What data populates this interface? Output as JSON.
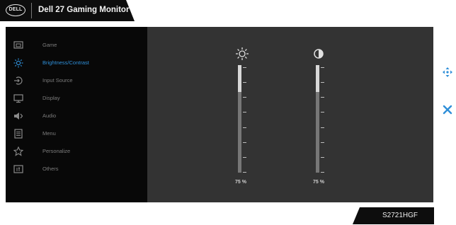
{
  "header": {
    "logo_text": "DELL",
    "title": "Dell 27 Gaming Monitor"
  },
  "menu": {
    "items": [
      {
        "label": "Game",
        "icon": "game-icon",
        "active": false
      },
      {
        "label": "Brightness/Contrast",
        "icon": "brightness-icon",
        "active": true
      },
      {
        "label": "Input Source",
        "icon": "input-source-icon",
        "active": false
      },
      {
        "label": "Display",
        "icon": "display-icon",
        "active": false
      },
      {
        "label": "Audio",
        "icon": "audio-icon",
        "active": false
      },
      {
        "label": "Menu",
        "icon": "menu-icon",
        "active": false
      },
      {
        "label": "Personalize",
        "icon": "personalize-icon",
        "active": false
      },
      {
        "label": "Others",
        "icon": "others-icon",
        "active": false
      }
    ]
  },
  "brightness": {
    "icon": "sun-icon",
    "value": 75,
    "value_label": "75 %"
  },
  "contrast": {
    "icon": "contrast-icon",
    "value": 75,
    "value_label": "75 %"
  },
  "nav": {
    "up_down": "joystick-icon",
    "exit": "close-icon"
  },
  "model": "S2721HGF",
  "colors": {
    "accent": "#2f8fd8",
    "panel": "#080808",
    "content": "#333333"
  }
}
